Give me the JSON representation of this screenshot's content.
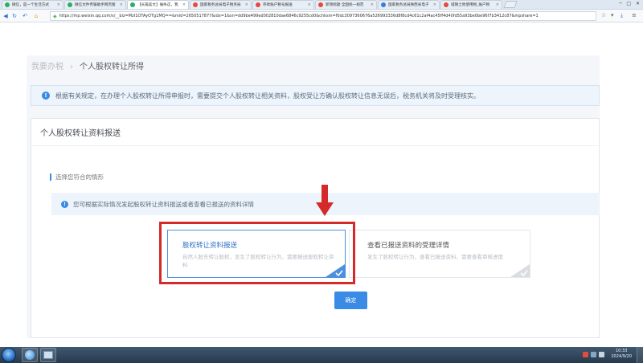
{
  "browser": {
    "tabs": [
      {
        "title": "微信，是一个生活方式",
        "favicon_color": "#2aae67"
      },
      {
        "title": "微信文件传输助手网页版",
        "favicon_color": "#2aae67"
      },
      {
        "title": "【长篇美文】痛失这，我",
        "favicon_color": "#2aae67"
      },
      {
        "title": "国家税务总局电子税务局",
        "favicon_color": "#e34b3c"
      },
      {
        "title": "存款账户税号报送",
        "favicon_color": "#e34b3c"
      },
      {
        "title": "新增标题·全国统一规范",
        "favicon_color": "#e34b3c"
      },
      {
        "title": "国家税务总局陕西省电子",
        "favicon_color": "#3a7de0"
      },
      {
        "title": "城镇土地使用税_账户税",
        "favicon_color": "#e34b3c"
      }
    ],
    "active_tab": 2,
    "url": "https://mp.weixin.qq.com/s/__biz=MzI1OTAyOTg1MQ==&mid=2650517877&idx=1&sn=dd9be499ed002810dae6846c9255cd0&chksm=f0dc3097360676a526993336d8f8cd4c61c2af4ac45ff4d40fd55a93be0be96f7b3412c87&mpshare=1"
  },
  "breadcrumb": {
    "root": "我要办税",
    "sep": "›",
    "current": "个人股权转让所得"
  },
  "notice": {
    "text": "根据有关规定，在办理个人股权转让所得申报时，需要提交个人股权转让相关资料，股权受让方确认股权转让信息无误后，税务机关将及时受理核实。"
  },
  "card": {
    "title": "个人股权转让资料报送"
  },
  "section": {
    "heading": "选择您符合的情形"
  },
  "hint": {
    "text": "您可根据实际情况发起股权转让资料报送或者查看已报送的资料详情"
  },
  "options": {
    "transfer_report": {
      "title": "股权转让资料报送",
      "desc": "自然人股东转让股权，发生了股权转让行为，需要报送股权转让资料",
      "selected": true
    },
    "view_status": {
      "title": "查看已报送资料的受理详情",
      "desc": "发生了股权转让行为，查看已报送资料，需要查看审核进度",
      "selected": false
    }
  },
  "confirm": {
    "label": "确定"
  },
  "taskbar": {
    "time": "10:33",
    "date": "2024/9/20"
  },
  "colors": {
    "accent": "#3a8be6",
    "highlight_red": "#d52a2a",
    "wechat_green": "#2aae67"
  }
}
